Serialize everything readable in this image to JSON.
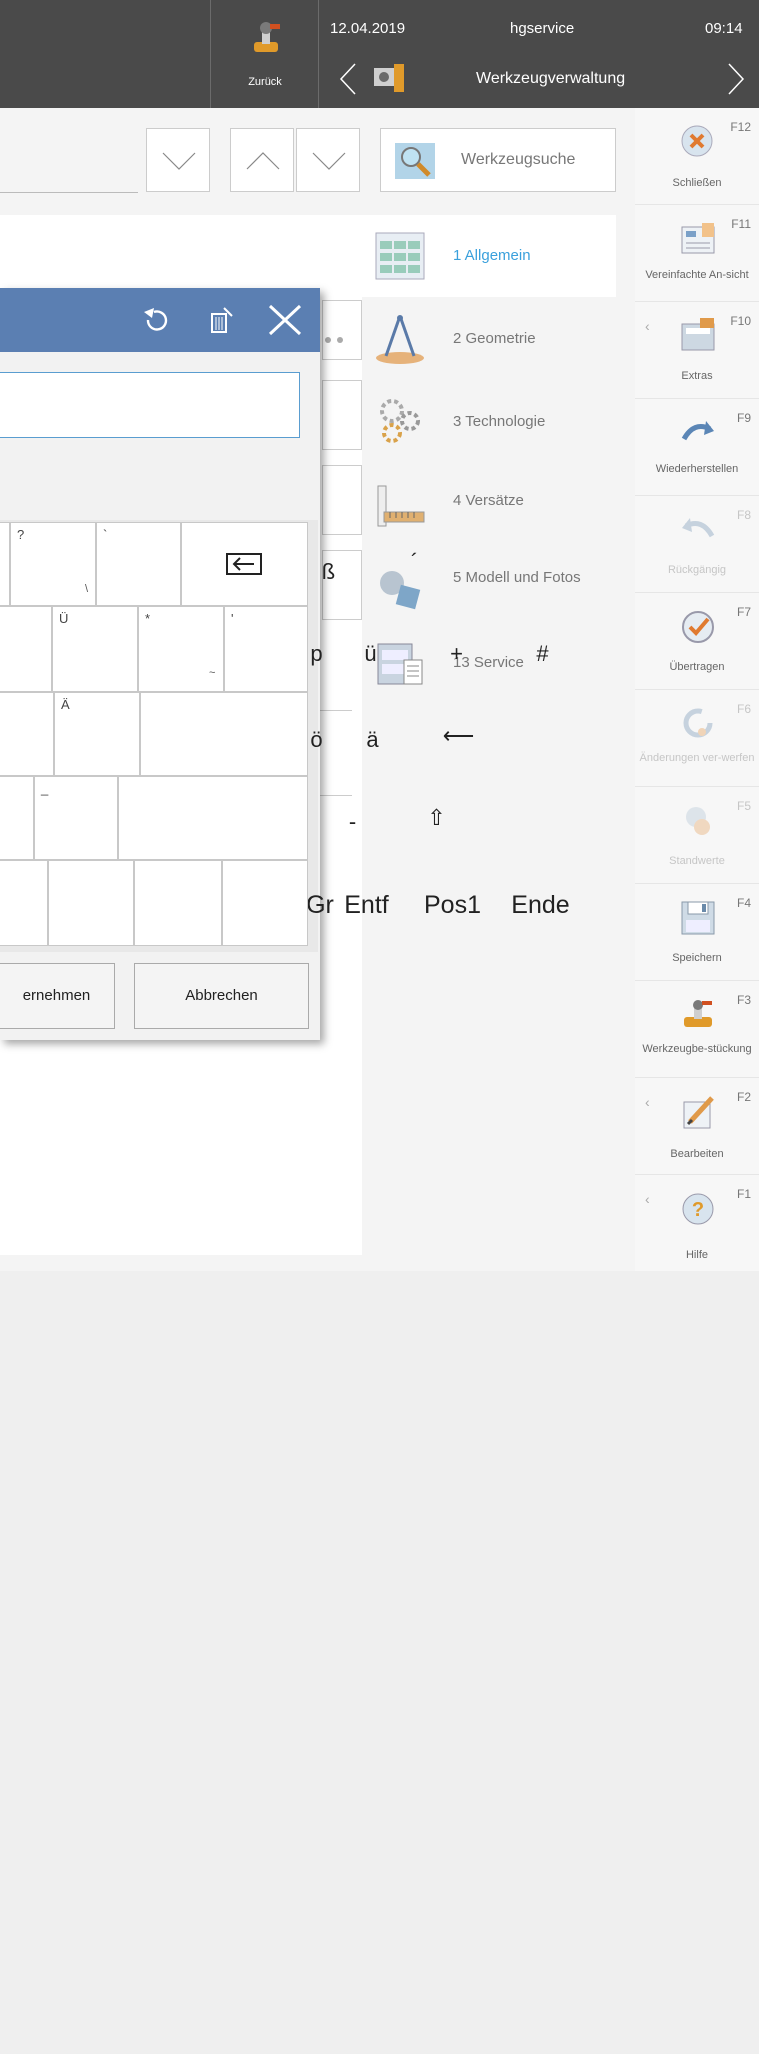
{
  "topbar": {
    "back_label": "Zurück",
    "date": "12.04.2019",
    "user": "hgservice",
    "time": "09:14",
    "title": "Werkzeugverwaltung"
  },
  "search": {
    "button_label": "Werkzeugsuche"
  },
  "categories": [
    {
      "label": "1 Allgemein",
      "icon": "list-icon"
    },
    {
      "label": "2 Geometrie",
      "icon": "compass-icon"
    },
    {
      "label": "3 Technologie",
      "icon": "gears-icon"
    },
    {
      "label": "4 Versätze",
      "icon": "ruler-icon"
    },
    {
      "label": "5 Modell und Fotos",
      "icon": "shapes-icon"
    },
    {
      "label": "13 Service",
      "icon": "cabinet-icon"
    }
  ],
  "right_panel": [
    {
      "key": "F12",
      "label": "Schließen",
      "icon": "close-circle-icon"
    },
    {
      "key": "F11",
      "label": "Vereinfachte An-sicht",
      "icon": "simple-view-icon"
    },
    {
      "key": "F10",
      "label": "Extras",
      "icon": "extras-icon"
    },
    {
      "key": "F9",
      "label": "Wiederherstellen",
      "icon": "redo-icon"
    },
    {
      "key": "F8",
      "label": "Rückgängig",
      "icon": "undo-icon"
    },
    {
      "key": "F7",
      "label": "Übertragen",
      "icon": "transfer-icon"
    },
    {
      "key": "F6",
      "label": "Änderungen ver-werfen",
      "icon": "discard-icon"
    },
    {
      "key": "F5",
      "label": "Standwerte",
      "icon": "default-values-icon"
    },
    {
      "key": "F4",
      "label": "Speichern",
      "icon": "save-icon"
    },
    {
      "key": "F3",
      "label": "Werkzeugbe-stückung",
      "icon": "tool-loading-icon"
    },
    {
      "key": "F2",
      "label": "Bearbeiten",
      "icon": "edit-icon"
    },
    {
      "key": "F1",
      "label": "Hilfe",
      "icon": "help-icon"
    }
  ],
  "keyboard": {
    "row1": [
      {
        "main": "ß",
        "sup": "?",
        "sub": "\\"
      },
      {
        "main": "´",
        "sup": "`",
        "sub": ""
      },
      {
        "main": "⇤",
        "sup": "",
        "sub": ""
      }
    ],
    "row2": [
      {
        "main": "p",
        "sup": "",
        "sub": ""
      },
      {
        "main": "ü",
        "sup": "Ü",
        "sub": ""
      },
      {
        "main": "+",
        "sup": "*",
        "sub": "~"
      },
      {
        "main": "#",
        "sup": "'",
        "sub": ""
      }
    ],
    "row3": [
      {
        "main": "ö",
        "sup": "",
        "sub": ""
      },
      {
        "main": "ä",
        "sup": "Ä",
        "sub": ""
      },
      {
        "main": "⟵",
        "sup": "",
        "sub": ""
      }
    ],
    "row4": [
      {
        "main": "-",
        "sup": "_",
        "sub": ""
      },
      {
        "main": "⇧",
        "sup": "",
        "sub": ""
      }
    ],
    "row5": [
      {
        "main": "tGr"
      },
      {
        "main": "Entf"
      },
      {
        "main": "Pos1"
      },
      {
        "main": "Ende"
      }
    ],
    "accept_label": "ernehmen",
    "cancel_label": "Abbrechen"
  }
}
